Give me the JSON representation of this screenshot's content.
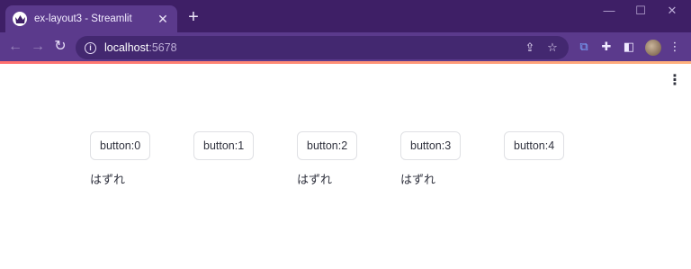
{
  "browser": {
    "tab_title": "ex-layout3 - Streamlit",
    "tab_close": "✕",
    "new_tab": "+",
    "window_controls": {
      "minimize": "—",
      "maximize": "☐",
      "close": "✕"
    },
    "url_host": "localhost",
    "url_port": ":5678",
    "nav": {
      "back": "←",
      "forward": "→",
      "reload": "↻"
    }
  },
  "app": {
    "menu_glyph": "⋮",
    "buttons": [
      "button:0",
      "button:1",
      "button:2",
      "button:3",
      "button:4"
    ],
    "results": [
      "はずれ",
      "",
      "はずれ",
      "はずれ",
      ""
    ]
  },
  "colors": {
    "tabstrip": "#3e1f66",
    "toolbar": "#5b3a8c",
    "omnibox": "#432870",
    "app_text": "#31333f",
    "button_border": "#dfe0e4"
  }
}
